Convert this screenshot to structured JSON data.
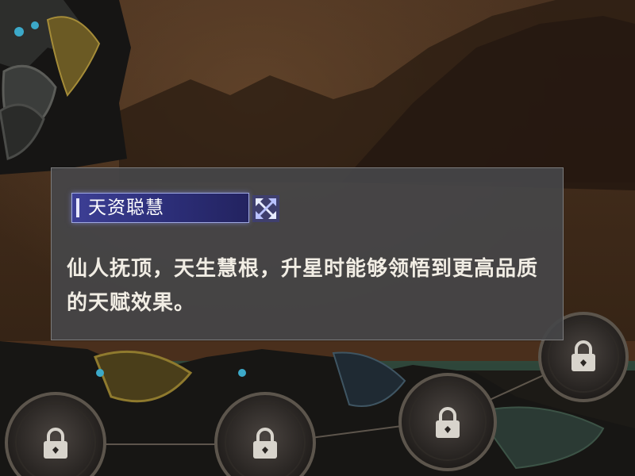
{
  "tooltip": {
    "tag_label": "天资聪慧",
    "description": "仙人抚顶，天生慧根，升星时能够领悟到更高品质的天赋效果。"
  },
  "icons": {
    "tag_icon": "crossed-chain-icon",
    "locks": [
      "lock-icon",
      "lock-icon",
      "lock-icon",
      "lock-icon"
    ]
  },
  "colors": {
    "tag_background": "#2c2e78",
    "tooltip_background": "#464648",
    "text": "#f1ede4"
  }
}
